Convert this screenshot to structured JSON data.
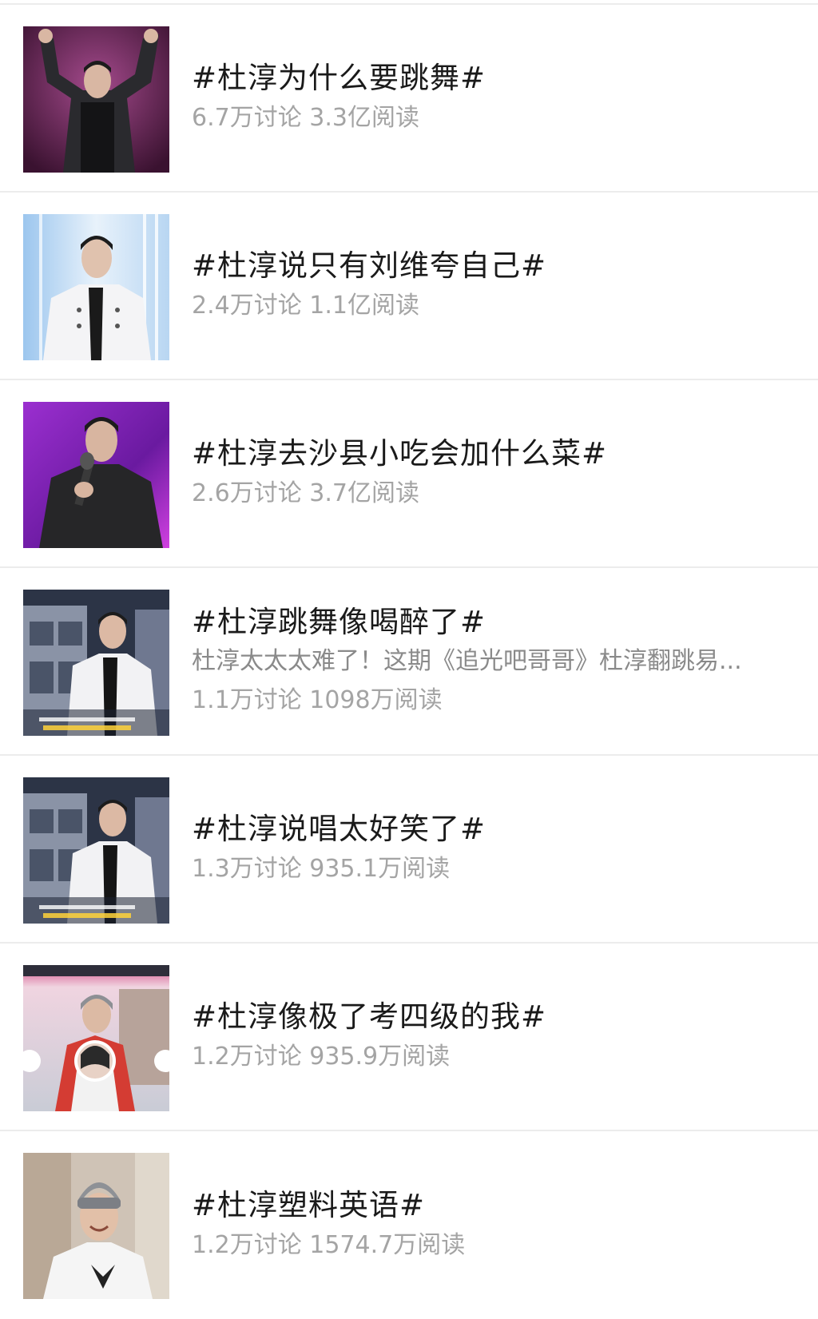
{
  "topics": [
    {
      "title": "#杜淳为什么要跳舞#",
      "stats": "6.7万讨论 3.3亿阅读",
      "thumb_icon": "photo-performer-arms-raised"
    },
    {
      "title": "#杜淳说只有刘维夸自己#",
      "stats": "2.4万讨论 1.1亿阅读",
      "thumb_icon": "photo-performer-white-jacket"
    },
    {
      "title": "#杜淳去沙县小吃会加什么菜#",
      "stats": "2.6万讨论 3.7亿阅读",
      "thumb_icon": "photo-performer-microphone"
    },
    {
      "title": "#杜淳跳舞像喝醉了#",
      "desc": "杜淳太太太难了！这期《追光吧哥哥》杜淳翻跳易...",
      "stats": "1.1万讨论 1098万阅读",
      "thumb_icon": "photo-stage-dance"
    },
    {
      "title": "#杜淳说唱太好笑了#",
      "stats": "1.3万讨论 935.1万阅读",
      "thumb_icon": "photo-stage-dance"
    },
    {
      "title": "#杜淳像极了考四级的我#",
      "stats": "1.2万讨论 935.9万阅读",
      "thumb_icon": "photo-variety-show"
    },
    {
      "title": "#杜淳塑料英语#",
      "stats": "1.2万讨论 1574.7万阅读",
      "thumb_icon": "photo-performer-beanie"
    }
  ]
}
